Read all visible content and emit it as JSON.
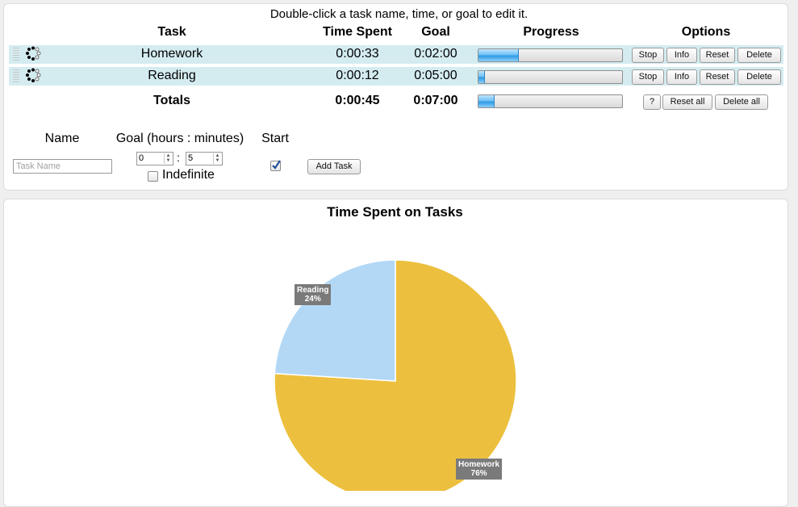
{
  "hint": "Double-click a task name, time, or goal to edit it.",
  "headers": {
    "task": "Task",
    "time_spent": "Time Spent",
    "goal": "Goal",
    "progress": "Progress",
    "options": "Options"
  },
  "tasks": [
    {
      "name": "Homework",
      "time": "0:00:33",
      "goal": "0:02:00",
      "progress": 0.275
    },
    {
      "name": "Reading",
      "time": "0:00:12",
      "goal": "0:05:00",
      "progress": 0.04
    }
  ],
  "row_buttons": {
    "stop": "Stop",
    "info": "Info",
    "reset": "Reset",
    "delete": "Delete"
  },
  "totals": {
    "label": "Totals",
    "time": "0:00:45",
    "goal": "0:07:00",
    "progress": 0.107,
    "help": "?",
    "reset_all": "Reset all",
    "delete_all": "Delete all"
  },
  "new_task": {
    "name_label": "Name",
    "goal_label": "Goal (hours : minutes)",
    "start_label": "Start",
    "name_placeholder": "Task Name",
    "hours": "0",
    "separator": ":",
    "minutes": "5",
    "indefinite_label": "Indefinite",
    "indefinite_checked": false,
    "start_checked": true,
    "add_button": "Add Task"
  },
  "chart_data": {
    "type": "pie",
    "title": "Time Spent on Tasks",
    "slices": [
      {
        "label": "Homework",
        "pct_label": "76%",
        "value": 76,
        "color": "#ecc03e"
      },
      {
        "label": "Reading",
        "pct_label": "24%",
        "value": 24,
        "color": "#b3d8f6"
      }
    ]
  }
}
